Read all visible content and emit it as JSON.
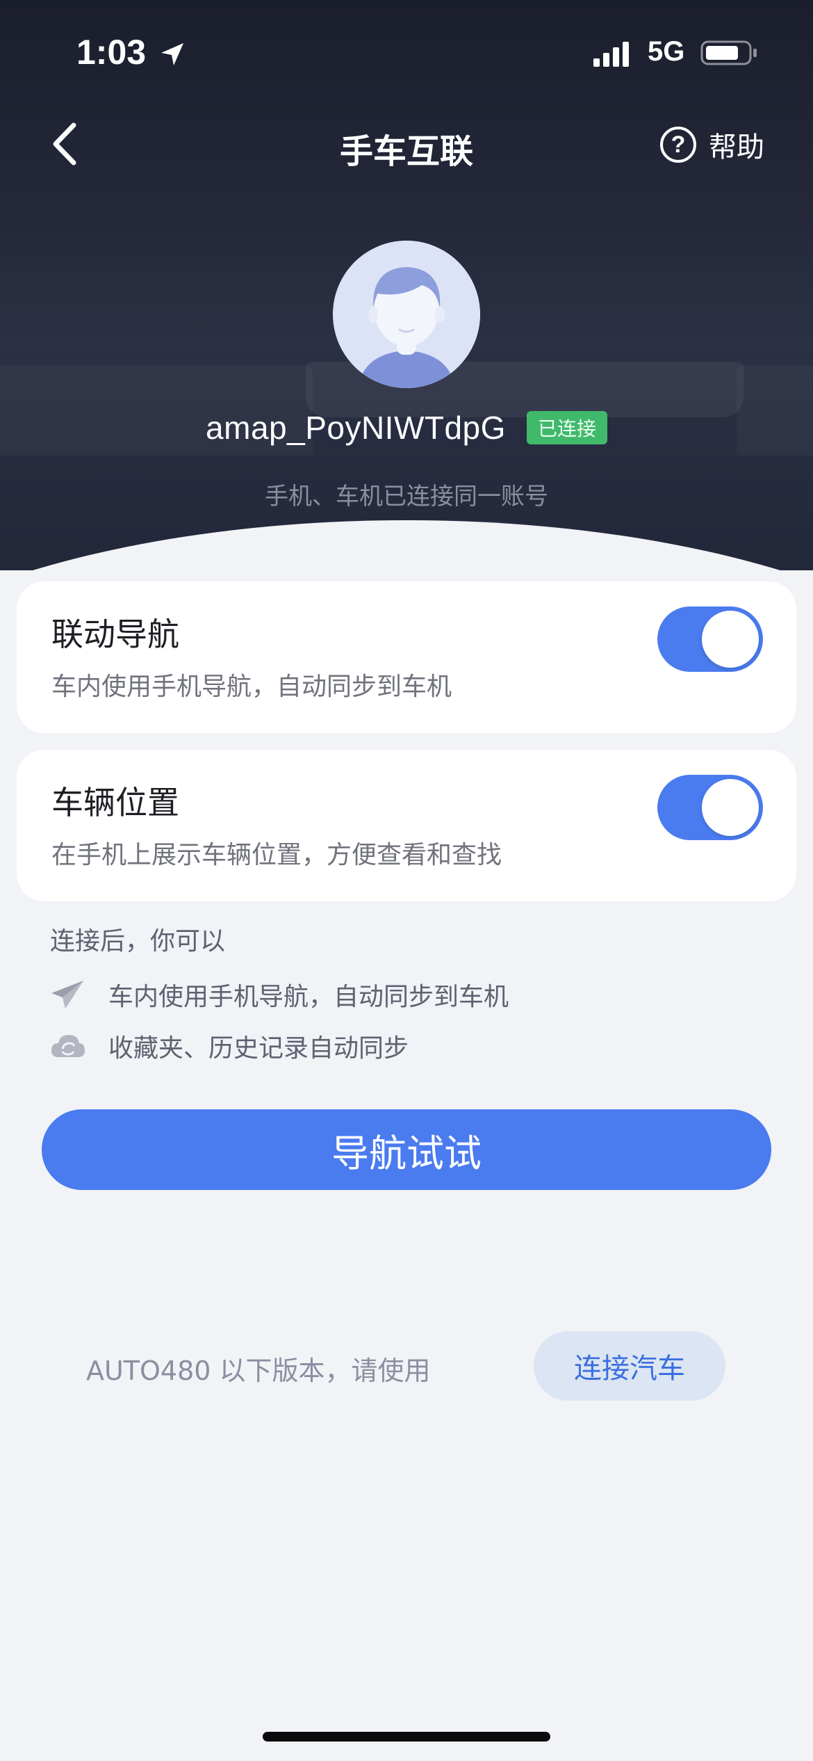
{
  "status_bar": {
    "time": "1:03",
    "network": "5G"
  },
  "header": {
    "title": "手车互联",
    "help_label": "帮助"
  },
  "user": {
    "name": "amap_PoyNIWTdpG",
    "badge": "已连接",
    "note": "手机、车机已连接同一账号"
  },
  "cards": [
    {
      "title": "联动导航",
      "desc": "车内使用手机导航，自动同步到车机",
      "toggle_on": true
    },
    {
      "title": "车辆位置",
      "desc": "在手机上展示车辆位置，方便查看和查找",
      "toggle_on": true
    }
  ],
  "after_connect": {
    "title": "连接后，你可以",
    "features": [
      {
        "icon": "paper-plane-icon",
        "text": "车内使用手机导航，自动同步到车机"
      },
      {
        "icon": "cloud-sync-icon",
        "text": "收藏夹、历史记录自动同步"
      }
    ]
  },
  "primary_button": "导航试试",
  "legacy": {
    "text": "AUTO480 以下版本，请使用",
    "button": "连接汽车"
  },
  "colors": {
    "accent": "#4A7BEF",
    "badge_green": "#40B96B",
    "header_bg": "#1B1E2C",
    "page_bg": "#F1F3F7"
  }
}
